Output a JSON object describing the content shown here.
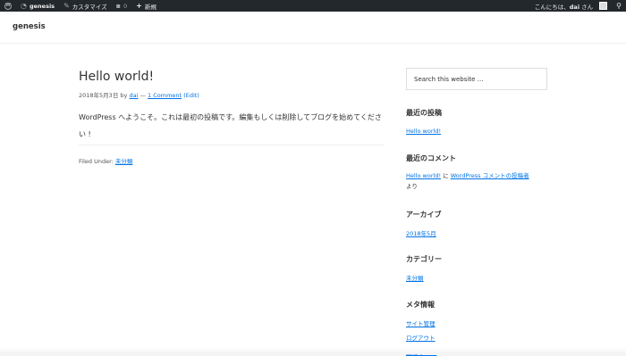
{
  "adminbar": {
    "site_name": "genesis",
    "customize": "カスタマイズ",
    "comments_count": "0",
    "new": "新規",
    "greeting": "こんにちは、",
    "user": "dai",
    "suffix": " さん"
  },
  "header": {
    "site_title": "genesis"
  },
  "post": {
    "title": "Hello world!",
    "date": "2018年5月3日",
    "by": "by",
    "author": "dai",
    "dash": "—",
    "comments": "1 Comment",
    "edit": "(Edit)",
    "content": "WordPress へようこそ。これは最初の投稿です。編集もしくは削除してブログを始めてください !",
    "filed_label": "Filed Under:",
    "category": "未分類"
  },
  "sidebar": {
    "search_placeholder": "Search this website …",
    "recent_posts_title": "最近の投稿",
    "recent_post_1": "Hello world!",
    "recent_comments_title": "最近のコメント",
    "comment_post": "Hello world!",
    "comment_on": " に ",
    "comment_author": "WordPress コメントの投稿者",
    "comment_from": "より",
    "archives_title": "アーカイブ",
    "archive_1": "2018年5月",
    "categories_title": "カテゴリー",
    "category_1": "未分類",
    "meta_title": "メタ情報",
    "meta_1": "サイト管理",
    "meta_2": "ログアウト",
    "meta_3": "投稿の RSS"
  },
  "colors": {
    "link": "#0073e5",
    "adminbar": "#23282d"
  }
}
